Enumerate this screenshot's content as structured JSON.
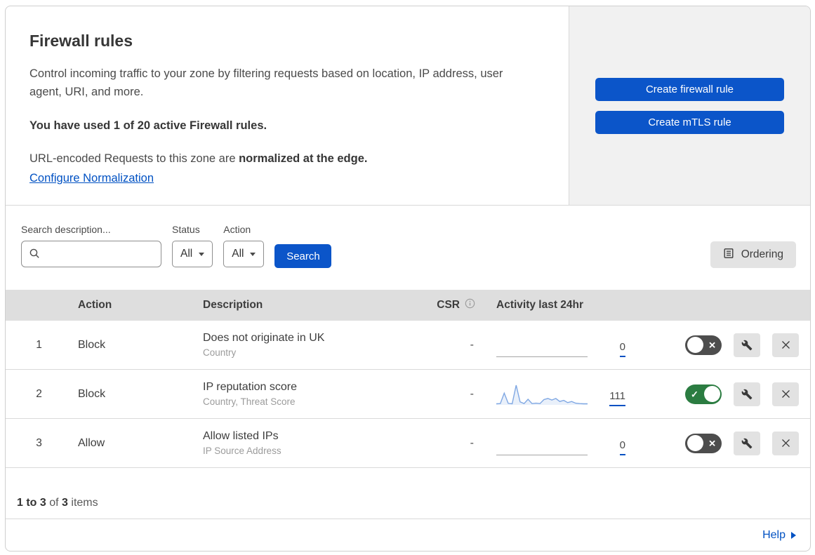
{
  "colors": {
    "accent_blue": "#0b55c9",
    "link_blue": "#0051c3",
    "toggle_on_green": "#2b7c41",
    "toggle_off_gray": "#4d4d4d",
    "sparkline_stroke": "#7fa7e3",
    "sparkline_fill": "#e9f0fa",
    "table_header_bg": "#dedede",
    "side_panel_bg": "#f1f1f1"
  },
  "icons": {
    "toggle_on": "✓",
    "toggle_off": "✕"
  },
  "header": {
    "title": "Firewall rules",
    "description": "Control incoming traffic to your zone by filtering requests based on location, IP address, user agent, URI, and more.",
    "usage": "You have used 1 of 20 active Firewall rules.",
    "normalization_text": "URL-encoded Requests to this zone are ",
    "normalization_bold": "normalized at the edge.",
    "normalization_link": "Configure Normalization",
    "create_firewall_button": "Create firewall rule",
    "create_mtls_button": "Create mTLS rule"
  },
  "filters": {
    "search_label": "Search description...",
    "status_label": "Status",
    "status_value": "All",
    "action_label": "Action",
    "action_value": "All",
    "search_button": "Search",
    "ordering_button": "Ordering"
  },
  "table": {
    "headers": {
      "action": "Action",
      "description": "Description",
      "csr": "CSR",
      "activity": "Activity last 24hr"
    },
    "rows": [
      {
        "index": "1",
        "action": "Block",
        "description": "Does not originate in UK",
        "fields": "Country",
        "csr": "-",
        "activity_count": "0",
        "enabled": false,
        "sparkline": []
      },
      {
        "index": "2",
        "action": "Block",
        "description": "IP reputation score",
        "fields": "Country, Threat Score",
        "csr": "-",
        "activity_count": "111",
        "enabled": true,
        "sparkline": [
          2,
          3,
          58,
          4,
          2,
          100,
          12,
          3,
          26,
          3,
          5,
          3,
          24,
          30,
          22,
          30,
          14,
          20,
          8,
          14,
          5,
          3,
          2,
          2
        ]
      },
      {
        "index": "3",
        "action": "Allow",
        "description": "Allow listed IPs",
        "fields": "IP Source Address",
        "csr": "-",
        "activity_count": "0",
        "enabled": false,
        "sparkline": []
      }
    ]
  },
  "footer": {
    "range": "1 to 3",
    "of": "of",
    "total": "3",
    "items_label": "items",
    "help": "Help"
  }
}
